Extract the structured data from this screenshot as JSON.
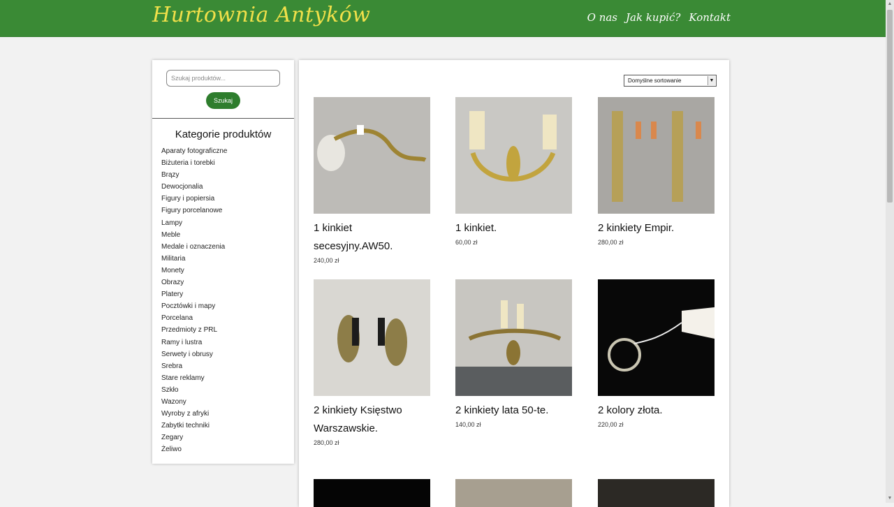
{
  "header": {
    "logo": "Hurtownia Antyków",
    "nav": [
      "O nas",
      "Jak kupić?",
      "Kontakt"
    ]
  },
  "sidebar": {
    "search_placeholder": "Szukaj produktów...",
    "search_button": "Szukaj",
    "categories_title": "Kategorie produktów",
    "categories": [
      "Aparaty fotograficzne",
      "Biżuteria i torebki",
      "Brązy",
      "Dewocjonalia",
      "Figury i popiersia",
      "Figury porcelanowe",
      "Lampy",
      "Meble",
      "Medale i oznaczenia",
      "Militaria",
      "Monety",
      "Obrazy",
      "Platery",
      "Pocztówki i mapy",
      "Porcelana",
      "Przedmioty z PRL",
      "Ramy i lustra",
      "Serwety i obrusy",
      "Srebra",
      "Stare reklamy",
      "Szkło",
      "Wazony",
      "Wyroby z afryki",
      "Zabytki techniki",
      "Zegary",
      "Żeliwo"
    ]
  },
  "main": {
    "sort_label": "Domyślne sortowanie",
    "products": [
      {
        "title": "1 kinkiet secesyjny.AW50.",
        "price": "240,00 zł"
      },
      {
        "title": "1 kinkiet.",
        "price": "60,00 zł"
      },
      {
        "title": "2 kinkiety Empir.",
        "price": "280,00 zł"
      },
      {
        "title": "2 kinkiety Księstwo Warszawskie.",
        "price": "280,00 zł"
      },
      {
        "title": "2 kinkiety lata 50-te.",
        "price": "140,00 zł"
      },
      {
        "title": "2 kolory złota.",
        "price": "220,00 zł"
      }
    ]
  },
  "colors": {
    "header": "#3a8a35",
    "logo": "#f1e04a",
    "button": "#2e7d2d"
  }
}
